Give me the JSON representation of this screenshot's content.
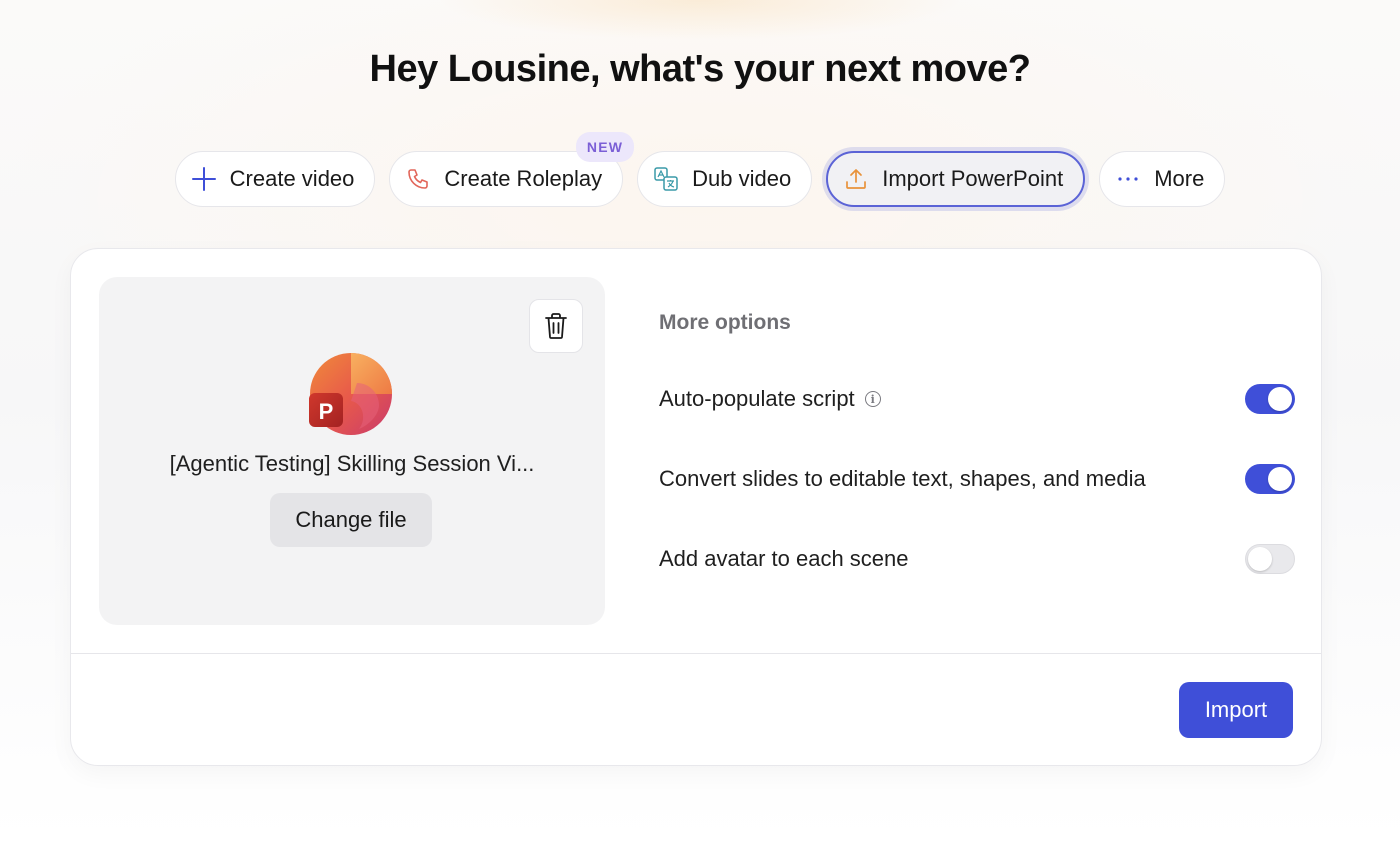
{
  "header": {
    "title": "Hey Lousine, what's your next move?"
  },
  "actions": [
    {
      "label": "Create video",
      "icon": "plus-icon"
    },
    {
      "label": "Create Roleplay",
      "icon": "phone-icon",
      "badge": "NEW"
    },
    {
      "label": "Dub video",
      "icon": "translate-icon"
    },
    {
      "label": "Import PowerPoint",
      "icon": "upload-icon",
      "active": true
    },
    {
      "label": "More",
      "icon": "ellipsis-icon"
    }
  ],
  "file": {
    "name": "[Agentic Testing] Skilling Session Vi...",
    "change_label": "Change file"
  },
  "options": {
    "title": "More options",
    "items": [
      {
        "label": "Auto-populate script",
        "has_info": true,
        "enabled": true
      },
      {
        "label": "Convert slides to editable text, shapes, and media",
        "has_info": false,
        "enabled": true
      },
      {
        "label": "Add avatar to each scene",
        "has_info": false,
        "enabled": false
      }
    ]
  },
  "footer": {
    "import_label": "Import"
  },
  "colors": {
    "accent": "#3f4fd8",
    "badge_bg": "#ece7fb",
    "badge_text": "#7b5fd6",
    "upload_icon": "#e8923a",
    "phone_icon": "#e2665a"
  }
}
